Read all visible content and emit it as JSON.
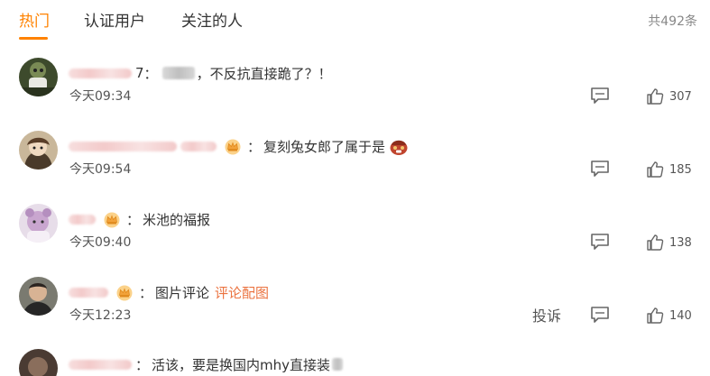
{
  "tabs": [
    {
      "label": "热门",
      "active": true
    },
    {
      "label": "认证用户",
      "active": false
    },
    {
      "label": "关注的人",
      "active": false
    }
  ],
  "total": "共492条",
  "accent_color": "#ff8200",
  "comments": [
    {
      "name_suffix": "7",
      "colon": "：",
      "text": "，不反抗直接跪了？！",
      "has_badge": false,
      "link": "",
      "time": "今天09:34",
      "likes": "307",
      "report": ""
    },
    {
      "name_suffix": "",
      "colon": "：",
      "text": "复刻兔女郎了属于是",
      "has_badge": true,
      "link": "",
      "time": "今天09:54",
      "likes": "185",
      "report": ""
    },
    {
      "name_suffix": "",
      "colon": "：",
      "text": "米池的福报",
      "has_badge": true,
      "link": "",
      "time": "今天09:40",
      "likes": "138",
      "report": ""
    },
    {
      "name_suffix": "",
      "colon": "：",
      "text": "图片评论",
      "has_badge": true,
      "link": "评论配图",
      "time": "今天12:23",
      "likes": "140",
      "report": "投诉"
    },
    {
      "name_suffix": "",
      "colon": "：",
      "text": "活该，要是换国内mhy直接装",
      "has_badge": false,
      "link": "",
      "time": "",
      "likes": "",
      "report": ""
    }
  ],
  "icons": {
    "badge": "crown-badge-icon",
    "reply": "comment-reply-icon",
    "like": "thumbs-up-icon",
    "emoji": "shy-face-emoji-icon"
  }
}
